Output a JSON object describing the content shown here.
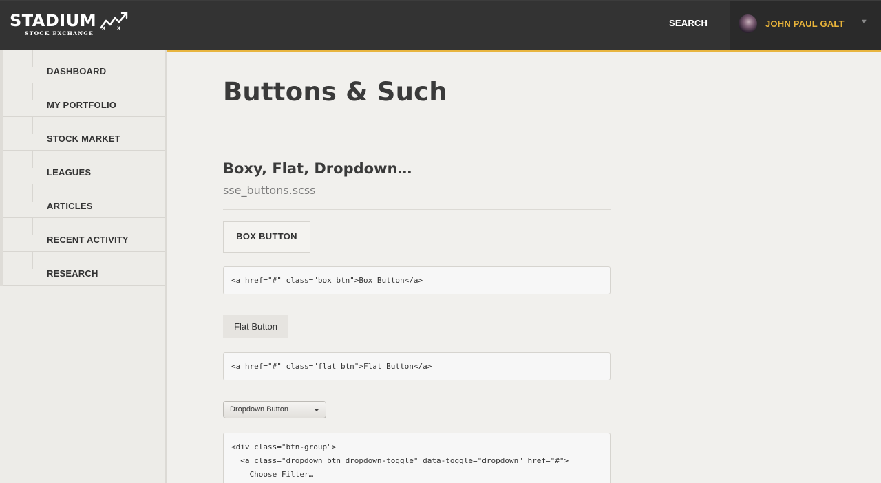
{
  "header": {
    "logo": {
      "word": "STADIUM",
      "sub": "STOCK EXCHANGE"
    },
    "search_label": "SEARCH",
    "user": {
      "name": "JOHN PAUL GALT",
      "caret": "▼"
    }
  },
  "sidebar": {
    "items": [
      {
        "label": "DASHBOARD"
      },
      {
        "label": "MY PORTFOLIO"
      },
      {
        "label": "STOCK MARKET"
      },
      {
        "label": "LEAGUES"
      },
      {
        "label": "ARTICLES"
      },
      {
        "label": "RECENT ACTIVITY"
      },
      {
        "label": "RESEARCH"
      }
    ]
  },
  "main": {
    "title": "Buttons & Such",
    "section": {
      "title": "Boxy, Flat, Dropdown…",
      "file": "sse_buttons.scss"
    },
    "box_button": {
      "label": "BOX BUTTON",
      "code": "<a href=\"#\" class=\"box btn\">Box Button</a>"
    },
    "flat_button": {
      "label": "Flat Button",
      "code": "<a href=\"#\" class=\"flat btn\">Flat Button</a>"
    },
    "dropdown_button": {
      "label": "Dropdown Button",
      "code_lines": [
        "<div class=\"btn-group\">",
        "  <a class=\"dropdown btn dropdown-toggle\" data-toggle=\"dropdown\" href=\"#\">",
        "    Choose Filter…"
      ]
    }
  },
  "colors": {
    "accent": "#e8b53f",
    "header_bg": "#333333",
    "user_bg": "#2a2a2a",
    "user_name": "#e9b43a",
    "page_bg": "#f1f0ed"
  }
}
